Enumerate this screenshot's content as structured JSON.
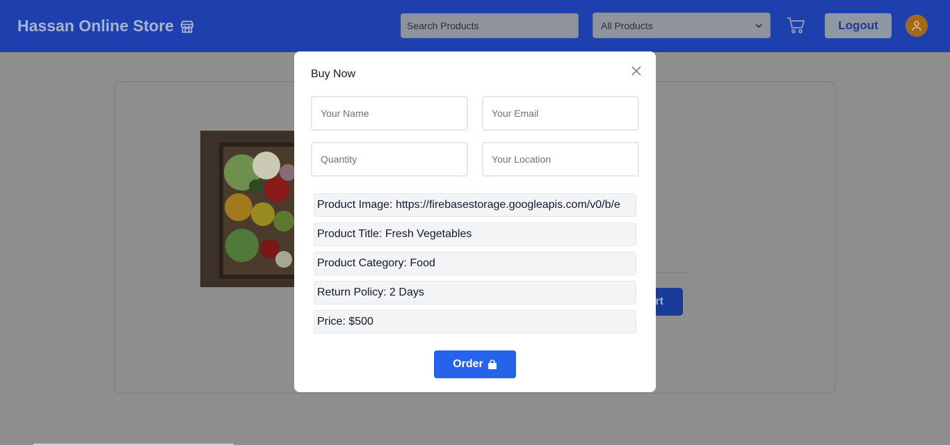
{
  "header": {
    "brand": "Hassan Online Store",
    "search_placeholder": "Search Products",
    "category_selected": "All Products",
    "logout_label": "Logout"
  },
  "modal": {
    "title": "Buy Now",
    "name_placeholder": "Your Name",
    "email_placeholder": "Your Email",
    "quantity_placeholder": "Quantity",
    "location_placeholder": "Your Location",
    "product_image": "Product Image: https://firebasestorage.googleapis.com/v0/b/e",
    "product_title": "Product Title: Fresh Vegetables",
    "product_category": "Product Category: Food",
    "return_policy": "Return Policy: 2 Days",
    "price": "Price: $500",
    "order_label": "Order"
  },
  "background_card": {
    "button_label_fragment": "rt"
  },
  "colors": {
    "navbar": "#1e40af",
    "order_button": "#2563eb",
    "avatar": "#d97706"
  }
}
